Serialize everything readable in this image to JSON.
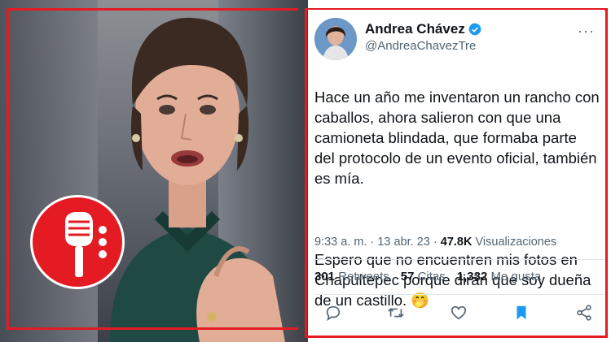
{
  "tweet": {
    "display_name": "Andrea Chávez",
    "handle": "@AndreaChavezTre",
    "paragraph1": "Hace un año me inventaron un rancho con caballos, ahora salieron con que una camioneta blindada, que formaba parte del protocolo de un evento oficial, también es mía.",
    "paragraph2": "Espero que no encuentren mis fotos en Chapultepec porque dirán que soy dueña de un castillo. 🤭",
    "time_date": "9:33 a. m. · 13 abr. 23 ·",
    "views_count": "47.8K",
    "views_label": "Visualizaciones",
    "retweets_count": "301",
    "retweets_label": "Retweets",
    "quotes_count": "57",
    "quotes_label": "Citas",
    "likes_count": "1,332",
    "likes_label": "Me gusta"
  },
  "icons": {
    "verified": "verified-badge-icon",
    "reply": "reply-icon",
    "retweet": "retweet-icon",
    "like": "heart-icon",
    "bookmark": "bookmark-icon",
    "share": "share-icon",
    "podcast": "microphone-icon"
  },
  "colors": {
    "accent_red": "#e41b23",
    "twitter_blue": "#1d9bf0",
    "text_primary": "#0f1419",
    "text_secondary": "#536471"
  }
}
